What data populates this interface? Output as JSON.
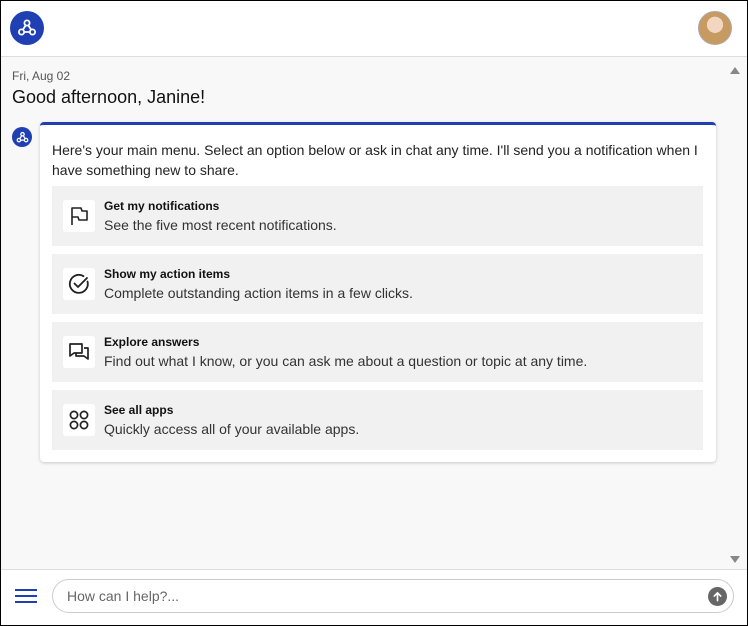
{
  "header": {
    "logo_icon": "hub-network-icon",
    "avatar_icon": "user-avatar"
  },
  "chat": {
    "date": "Fri, Aug 02",
    "greeting": "Good afternoon, Janine!",
    "intro": "Here's your main menu. Select an option below or ask in chat any time. I'll send you a notification when I have something new to share.",
    "menu": [
      {
        "title": "Get my notifications",
        "desc": "See the five most recent notifications.",
        "icon": "flag-icon"
      },
      {
        "title": "Show my action items",
        "desc": "Complete outstanding action items in a few clicks.",
        "icon": "check-circle-icon"
      },
      {
        "title": "Explore answers",
        "desc": "Find out what I know, or you can ask me about a question or topic at any time.",
        "icon": "chat-bubbles-icon"
      },
      {
        "title": "See all apps",
        "desc": "Quickly access all of your available apps.",
        "icon": "apps-grid-icon"
      }
    ]
  },
  "composer": {
    "placeholder": "How can I help?...",
    "value": ""
  },
  "colors": {
    "accent": "#1f3fb3",
    "item_bg": "#f1f1f2",
    "page_bg": "#f8f8f9"
  }
}
